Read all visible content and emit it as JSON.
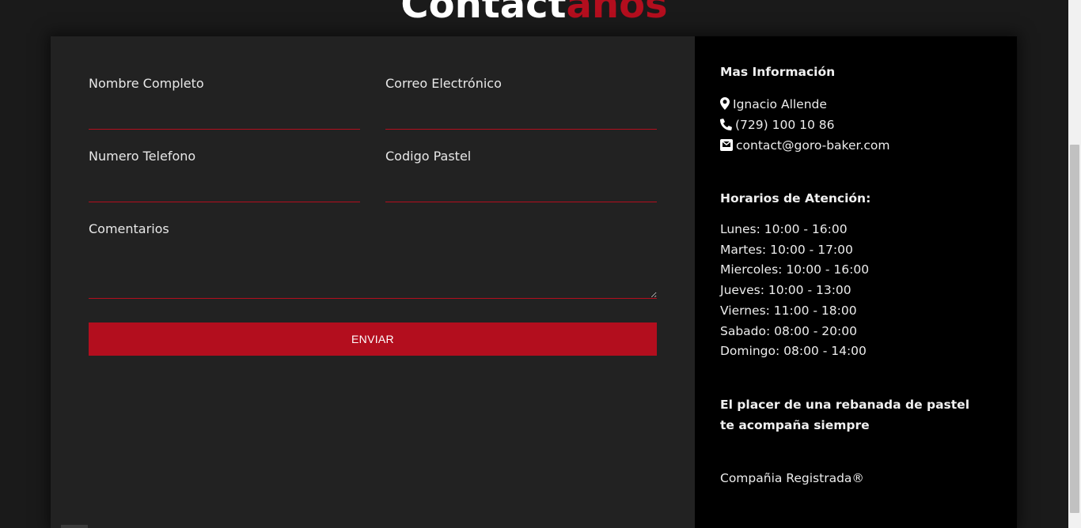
{
  "header": {
    "title_main": "Contact",
    "title_accent": "anos"
  },
  "form": {
    "fields": [
      {
        "label": "Nombre Completo",
        "value": ""
      },
      {
        "label": "Correo Electrónico",
        "value": ""
      },
      {
        "label": "Numero Telefono",
        "value": ""
      },
      {
        "label": "Codigo Pastel",
        "value": ""
      }
    ],
    "comments_label": "Comentarios",
    "comments_value": "",
    "submit_label": "ENVIAR"
  },
  "info": {
    "heading": "Mas Información",
    "location": "Ignacio Allende",
    "phone": "(729) 100 10 86",
    "email": "contact@goro-baker.com",
    "hours_heading": "Horarios de Atención:",
    "hours": [
      "Lunes: 10:00 - 16:00",
      "Martes: 10:00 - 17:00",
      "Miercoles: 10:00 - 16:00",
      "Jueves: 10:00 - 13:00",
      "Viernes: 11:00 - 18:00",
      "Sabado: 08:00 - 20:00",
      "Domingo: 08:00 - 14:00"
    ],
    "tagline": "El placer de una rebanada de pastel te acompaña siempre",
    "company": "Compañia Registrada®"
  },
  "icons": {
    "location": "map-marker-icon",
    "phone": "phone-icon",
    "email": "envelope-icon"
  },
  "colors": {
    "accent": "#b30e1e",
    "background": "#1a1a1a",
    "form_panel": "#222222",
    "info_panel": "#000000"
  }
}
